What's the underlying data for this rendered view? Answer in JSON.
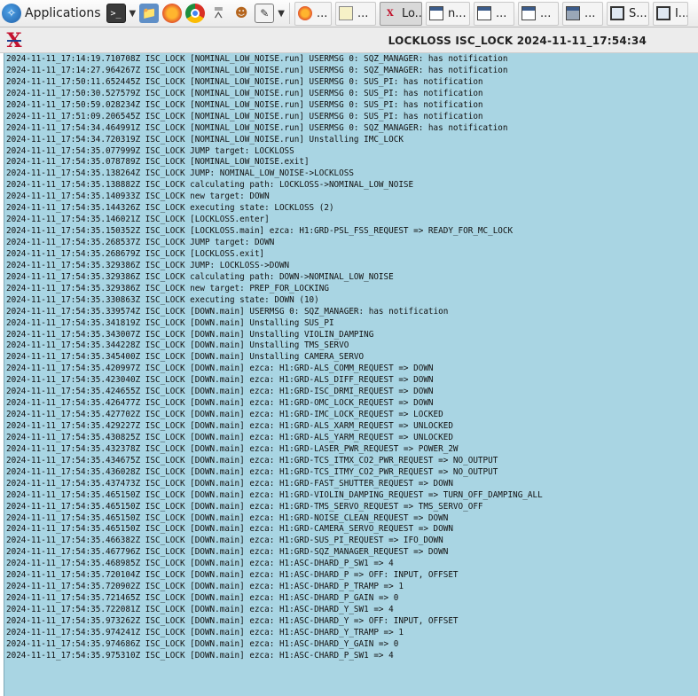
{
  "taskbar": {
    "applications_label": "Applications",
    "tasks": [
      {
        "icon": "firefox-icon",
        "label": "..."
      },
      {
        "icon": "notes-icon",
        "label": "..."
      },
      {
        "icon": "medm-icon",
        "label": "Lo..."
      },
      {
        "icon": "window-icon",
        "label": "n..."
      },
      {
        "icon": "window-icon",
        "label": "..."
      },
      {
        "icon": "window-icon",
        "label": "..."
      },
      {
        "icon": "window-icon",
        "label": "..."
      },
      {
        "icon": "monitor-icon",
        "label": "S..."
      },
      {
        "icon": "monitor-icon",
        "label": "I..."
      }
    ]
  },
  "window": {
    "title": "LOCKLOSS ISC_LOCK 2024-11-11_17:54:34"
  },
  "log": {
    "lines": [
      "2024-11-11_17:14:19.710708Z ISC_LOCK [NOMINAL_LOW_NOISE.run] USERMSG 0: SQZ_MANAGER: has notification",
      "2024-11-11_17:14:27.964267Z ISC_LOCK [NOMINAL_LOW_NOISE.run] USERMSG 0: SQZ_MANAGER: has notification",
      "2024-11-11_17:50:11.652445Z ISC_LOCK [NOMINAL_LOW_NOISE.run] USERMSG 0: SUS_PI: has notification",
      "2024-11-11_17:50:30.527579Z ISC_LOCK [NOMINAL_LOW_NOISE.run] USERMSG 0: SUS_PI: has notification",
      "2024-11-11_17:50:59.028234Z ISC_LOCK [NOMINAL_LOW_NOISE.run] USERMSG 0: SUS_PI: has notification",
      "2024-11-11_17:51:09.206545Z ISC_LOCK [NOMINAL_LOW_NOISE.run] USERMSG 0: SUS_PI: has notification",
      "2024-11-11_17:54:34.464991Z ISC_LOCK [NOMINAL_LOW_NOISE.run] USERMSG 0: SQZ_MANAGER: has notification",
      "2024-11-11_17:54:34.720319Z ISC_LOCK [NOMINAL_LOW_NOISE.run] Unstalling IMC_LOCK",
      "2024-11-11_17:54:35.077999Z ISC_LOCK JUMP target: LOCKLOSS",
      "2024-11-11_17:54:35.078789Z ISC_LOCK [NOMINAL_LOW_NOISE.exit]",
      "2024-11-11_17:54:35.138264Z ISC_LOCK JUMP: NOMINAL_LOW_NOISE->LOCKLOSS",
      "2024-11-11_17:54:35.138882Z ISC_LOCK calculating path: LOCKLOSS->NOMINAL_LOW_NOISE",
      "2024-11-11_17:54:35.140933Z ISC_LOCK new target: DOWN",
      "2024-11-11_17:54:35.144326Z ISC_LOCK executing state: LOCKLOSS (2)",
      "2024-11-11_17:54:35.146021Z ISC_LOCK [LOCKLOSS.enter]",
      "2024-11-11_17:54:35.150352Z ISC_LOCK [LOCKLOSS.main] ezca: H1:GRD-PSL_FSS_REQUEST => READY_FOR_MC_LOCK",
      "2024-11-11_17:54:35.268537Z ISC_LOCK JUMP target: DOWN",
      "2024-11-11_17:54:35.268679Z ISC_LOCK [LOCKLOSS.exit]",
      "2024-11-11_17:54:35.329386Z ISC_LOCK JUMP: LOCKLOSS->DOWN",
      "2024-11-11_17:54:35.329386Z ISC_LOCK calculating path: DOWN->NOMINAL_LOW_NOISE",
      "2024-11-11_17:54:35.329386Z ISC_LOCK new target: PREP_FOR_LOCKING",
      "2024-11-11_17:54:35.330863Z ISC_LOCK executing state: DOWN (10)",
      "2024-11-11_17:54:35.339574Z ISC_LOCK [DOWN.main] USERMSG 0: SQZ_MANAGER: has notification",
      "2024-11-11_17:54:35.341819Z ISC_LOCK [DOWN.main] Unstalling SUS_PI",
      "2024-11-11_17:54:35.343007Z ISC_LOCK [DOWN.main] Unstalling VIOLIN_DAMPING",
      "2024-11-11_17:54:35.344228Z ISC_LOCK [DOWN.main] Unstalling TMS_SERVO",
      "2024-11-11_17:54:35.345400Z ISC_LOCK [DOWN.main] Unstalling CAMERA_SERVO",
      "2024-11-11_17:54:35.420997Z ISC_LOCK [DOWN.main] ezca: H1:GRD-ALS_COMM_REQUEST => DOWN",
      "2024-11-11_17:54:35.423040Z ISC_LOCK [DOWN.main] ezca: H1:GRD-ALS_DIFF_REQUEST => DOWN",
      "2024-11-11_17:54:35.424655Z ISC_LOCK [DOWN.main] ezca: H1:GRD-ISC_DRMI_REQUEST => DOWN",
      "2024-11-11_17:54:35.426477Z ISC_LOCK [DOWN.main] ezca: H1:GRD-OMC_LOCK_REQUEST => DOWN",
      "2024-11-11_17:54:35.427702Z ISC_LOCK [DOWN.main] ezca: H1:GRD-IMC_LOCK_REQUEST => LOCKED",
      "2024-11-11_17:54:35.429227Z ISC_LOCK [DOWN.main] ezca: H1:GRD-ALS_XARM_REQUEST => UNLOCKED",
      "2024-11-11_17:54:35.430825Z ISC_LOCK [DOWN.main] ezca: H1:GRD-ALS_YARM_REQUEST => UNLOCKED",
      "2024-11-11_17:54:35.432378Z ISC_LOCK [DOWN.main] ezca: H1:GRD-LASER_PWR_REQUEST => POWER_2W",
      "2024-11-11_17:54:35.434675Z ISC_LOCK [DOWN.main] ezca: H1:GRD-TCS_ITMX_CO2_PWR_REQUEST => NO_OUTPUT",
      "2024-11-11_17:54:35.436028Z ISC_LOCK [DOWN.main] ezca: H1:GRD-TCS_ITMY_CO2_PWR_REQUEST => NO_OUTPUT",
      "2024-11-11_17:54:35.437473Z ISC_LOCK [DOWN.main] ezca: H1:GRD-FAST_SHUTTER_REQUEST => DOWN",
      "2024-11-11_17:54:35.465150Z ISC_LOCK [DOWN.main] ezca: H1:GRD-VIOLIN_DAMPING_REQUEST => TURN_OFF_DAMPING_ALL",
      "2024-11-11_17:54:35.465150Z ISC_LOCK [DOWN.main] ezca: H1:GRD-TMS_SERVO_REQUEST => TMS_SERVO_OFF",
      "2024-11-11_17:54:35.465150Z ISC_LOCK [DOWN.main] ezca: H1:GRD-NOISE_CLEAN_REQUEST => DOWN",
      "2024-11-11_17:54:35.465150Z ISC_LOCK [DOWN.main] ezca: H1:GRD-CAMERA_SERVO_REQUEST => DOWN",
      "2024-11-11_17:54:35.466382Z ISC_LOCK [DOWN.main] ezca: H1:GRD-SUS_PI_REQUEST => IFO_DOWN",
      "2024-11-11_17:54:35.467796Z ISC_LOCK [DOWN.main] ezca: H1:GRD-SQZ_MANAGER_REQUEST => DOWN",
      "2024-11-11_17:54:35.468985Z ISC_LOCK [DOWN.main] ezca: H1:ASC-DHARD_P_SW1 => 4",
      "2024-11-11_17:54:35.720104Z ISC_LOCK [DOWN.main] ezca: H1:ASC-DHARD_P => OFF: INPUT, OFFSET",
      "2024-11-11_17:54:35.720902Z ISC_LOCK [DOWN.main] ezca: H1:ASC-DHARD_P_TRAMP => 1",
      "2024-11-11_17:54:35.721465Z ISC_LOCK [DOWN.main] ezca: H1:ASC-DHARD_P_GAIN => 0",
      "2024-11-11_17:54:35.722081Z ISC_LOCK [DOWN.main] ezca: H1:ASC-DHARD_Y_SW1 => 4",
      "2024-11-11_17:54:35.973262Z ISC_LOCK [DOWN.main] ezca: H1:ASC-DHARD_Y => OFF: INPUT, OFFSET",
      "2024-11-11_17:54:35.974241Z ISC_LOCK [DOWN.main] ezca: H1:ASC-DHARD_Y_TRAMP => 1",
      "2024-11-11_17:54:35.974686Z ISC_LOCK [DOWN.main] ezca: H1:ASC-DHARD_Y_GAIN => 0",
      "2024-11-11_17:54:35.975310Z ISC_LOCK [DOWN.main] ezca: H1:ASC-CHARD_P_SW1 => 4"
    ]
  }
}
